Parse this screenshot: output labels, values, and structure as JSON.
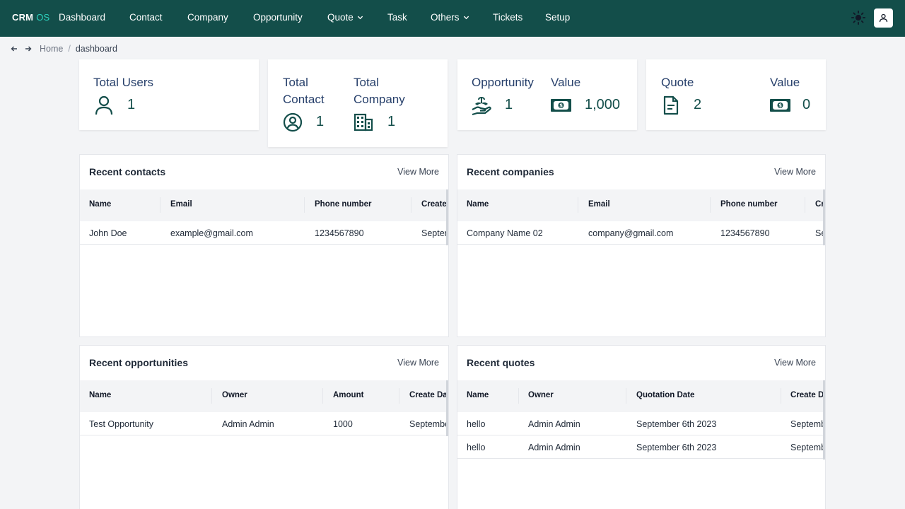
{
  "brand": {
    "part1": "CRM",
    "part2": "OS"
  },
  "nav": {
    "items": [
      "Dashboard",
      "Contact",
      "Company",
      "Opportunity",
      "Quote",
      "Task",
      "Others",
      "Tickets",
      "Setup"
    ]
  },
  "breadcrumb": {
    "home": "Home",
    "separator": "/",
    "current": "dashboard"
  },
  "stats": {
    "users": {
      "label": "Total Users",
      "value": "1"
    },
    "contact": {
      "label1": "Total",
      "label2": "Contact",
      "value": "1"
    },
    "company": {
      "label1": "Total",
      "label2": "Company",
      "value": "1"
    },
    "opportunity": {
      "label": "Opportunity",
      "value": "1",
      "value_label": "Value",
      "amount": "1,000"
    },
    "quote": {
      "label": "Quote",
      "value": "2",
      "value_label": "Value",
      "amount": "0"
    }
  },
  "panels": {
    "contacts": {
      "title": "Recent contacts",
      "view_more": "View More",
      "headers": [
        "Name",
        "Email",
        "Phone number",
        "Create"
      ],
      "rows": [
        [
          "John Doe",
          "example@gmail.com",
          "1234567890",
          "Septem"
        ]
      ]
    },
    "companies": {
      "title": "Recent companies",
      "view_more": "View More",
      "headers": [
        "Name",
        "Email",
        "Phone number",
        "Cre"
      ],
      "rows": [
        [
          "Company Name 02",
          "company@gmail.com",
          "1234567890",
          "Se"
        ]
      ]
    },
    "opportunities": {
      "title": "Recent opportunities",
      "view_more": "View More",
      "headers": [
        "Name",
        "Owner",
        "Amount",
        "Create Dat"
      ],
      "rows": [
        [
          "Test Opportunity",
          "Admin Admin",
          "1000",
          "Septembe"
        ]
      ]
    },
    "quotes": {
      "title": "Recent quotes",
      "view_more": "View More",
      "headers": [
        "Name",
        "Owner",
        "Quotation Date",
        "Create Da"
      ],
      "rows": [
        [
          "hello",
          "Admin Admin",
          "September 6th 2023",
          "Septemb"
        ],
        [
          "hello",
          "Admin Admin",
          "September 6th 2023",
          "Septemb"
        ]
      ]
    }
  },
  "colors": {
    "nav_bg": "#134e4a",
    "accent": "#2dd4bf",
    "icon": "#134e4a"
  }
}
